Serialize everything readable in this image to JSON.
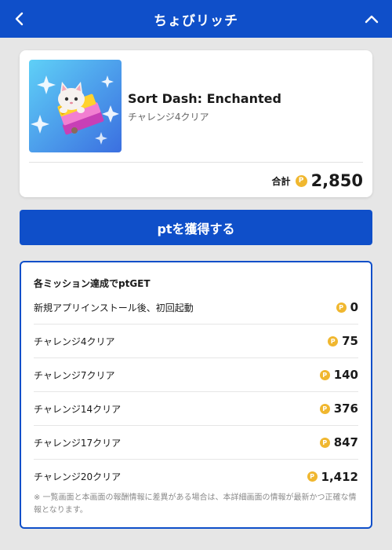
{
  "header": {
    "title": "ちょびリッチ",
    "back_icon": "chevron-left-icon",
    "collapse_icon": "chevron-up-icon"
  },
  "colors": {
    "brand": "#0f4fc9",
    "coin": "#f0b72f",
    "background": "#e6e6e6"
  },
  "app": {
    "name": "Sort Dash: Enchanted",
    "subtitle": "チャレンジ4クリア",
    "icon": "cat-with-books-app-icon",
    "total_label": "合計",
    "coin_symbol": "P",
    "total_value": "2,850"
  },
  "cta": {
    "label": "ptを獲得する"
  },
  "missions": {
    "heading": "各ミッション達成でptGET",
    "items": [
      {
        "label": "新規アプリインストール後、初回起動",
        "points": "0"
      },
      {
        "label": "チャレンジ4クリア",
        "points": "75"
      },
      {
        "label": "チャレンジ7クリア",
        "points": "140"
      },
      {
        "label": "チャレンジ14クリア",
        "points": "376"
      },
      {
        "label": "チャレンジ17クリア",
        "points": "847"
      },
      {
        "label": "チャレンジ20クリア",
        "points": "1,412"
      }
    ],
    "note": "※ 一覧画面と本画面の報酬情報に差異がある場合は、本詳細画面の情報が最新かつ正確な情報となります。"
  }
}
